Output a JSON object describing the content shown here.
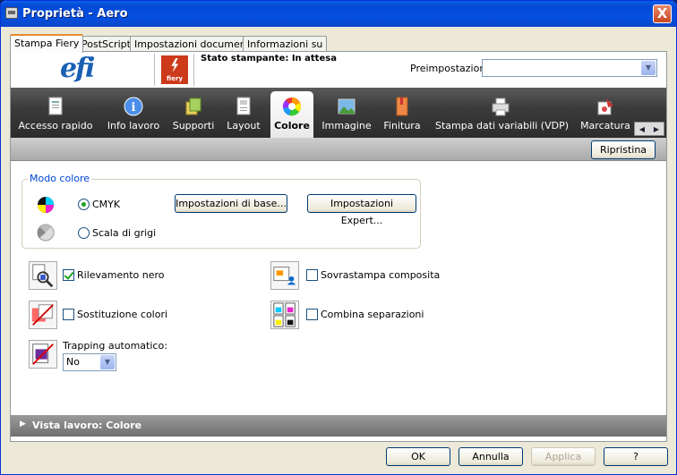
{
  "window": {
    "title": "Proprietà - Aero",
    "close_label": "X"
  },
  "tabs": [
    "Stampa Fiery",
    "PostScript",
    "Impostazioni documento",
    "Informazioni su"
  ],
  "header": {
    "logo": "efi",
    "fiery_logo": "fiery",
    "status": "Stato stampante: In attesa",
    "preset_label": "Preimpostazioni:",
    "preset_value": ""
  },
  "toolbar": {
    "items": [
      "Accesso rapido",
      "Info lavoro",
      "Supporti",
      "Layout",
      "Colore",
      "Immagine",
      "Finitura",
      "Stampa dati variabili (VDP)",
      "Marcatura"
    ],
    "active": "Colore",
    "scroll_left": "◀",
    "scroll_right": "▶"
  },
  "reset_button": "Ripristina",
  "color_mode": {
    "title": "Modo colore",
    "options": [
      "CMYK",
      "Scala di grigi"
    ],
    "selected": "CMYK",
    "basic_button": "Impostazioni di base...",
    "expert_button": "Impostazioni Expert..."
  },
  "options": {
    "black_detection": {
      "label": "Rilevamento nero",
      "checked": true
    },
    "color_substitution": {
      "label": "Sostituzione colori",
      "checked": false
    },
    "composite_overprint": {
      "label": "Sovrastampa composita",
      "checked": false
    },
    "combine_separations": {
      "label": "Combina separazioni",
      "checked": false
    },
    "auto_trapping": {
      "label": "Trapping automatico:",
      "value": "No"
    }
  },
  "job_view": {
    "label": "Vista lavoro: Colore",
    "arrow": "▶"
  },
  "buttons": {
    "ok": "OK",
    "cancel": "Annulla",
    "apply": "Applica",
    "help": "?"
  },
  "colors": {
    "title_bar": "#0550e0",
    "accent": "#e68b2c",
    "group_title": "#0046d5"
  },
  "icons": [
    "window-icon",
    "close-icon",
    "quick-access-icon",
    "info-icon",
    "media-icon",
    "layout-icon",
    "color-wheel-icon",
    "image-icon",
    "finishing-icon",
    "vdp-printer-icon",
    "stamp-icon",
    "cmyk-icon",
    "grayscale-icon",
    "black-detection-icon",
    "color-substitution-icon",
    "composite-overprint-icon",
    "combine-separations-icon",
    "trapping-icon"
  ]
}
